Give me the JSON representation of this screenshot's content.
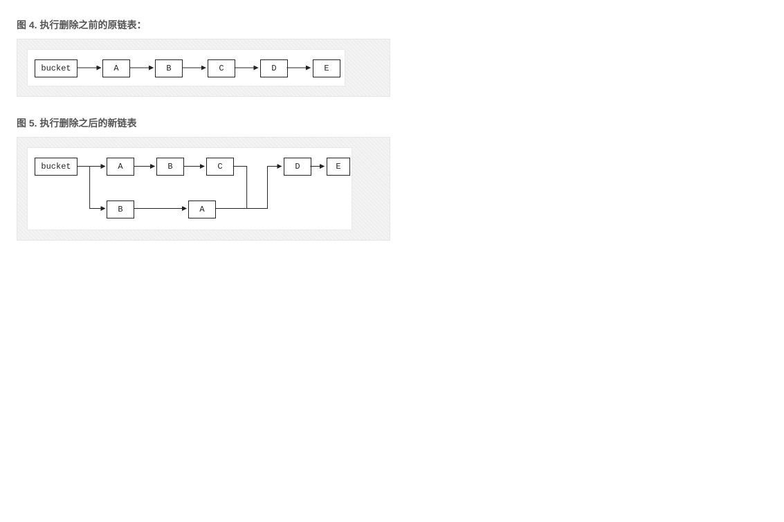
{
  "figures": {
    "fig4": {
      "title": "图 4. 执行删除之前的原链表："
    },
    "fig5": {
      "title": "图 5. 执行删除之后的新链表"
    }
  },
  "diagram4": {
    "nodes": {
      "bucket": "bucket",
      "a": "A",
      "b": "B",
      "c": "C",
      "d": "D",
      "e": "E"
    }
  },
  "diagram5": {
    "nodes": {
      "bucket": "bucket",
      "a": "A",
      "b": "B",
      "c": "C",
      "d": "D",
      "e": "E",
      "b2": "B",
      "a2": "A"
    }
  }
}
